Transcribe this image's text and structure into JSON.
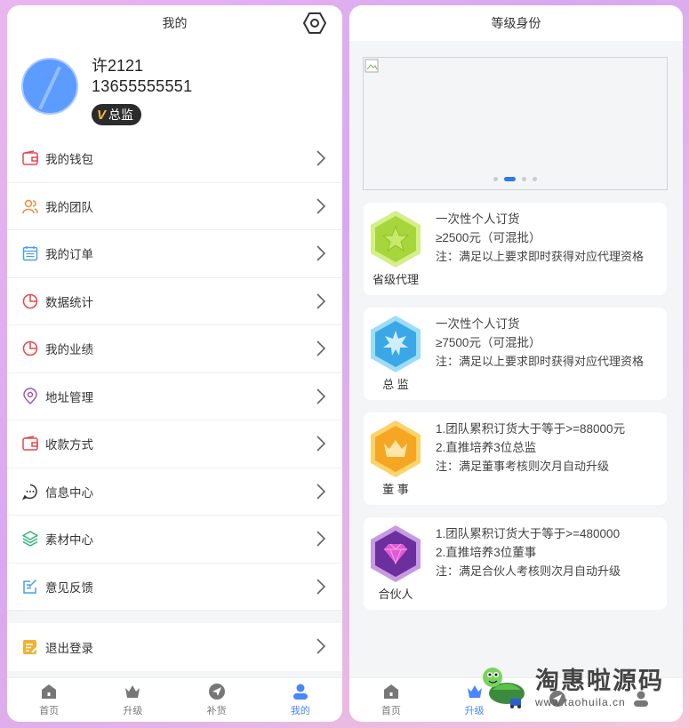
{
  "left": {
    "title": "我的",
    "user": {
      "name": "许2121",
      "phone": "13655555551",
      "level": "总监",
      "level_icon": "V"
    },
    "menu": [
      {
        "label": "我的钱包",
        "icon": "wallet-icon",
        "color": "#e5484d"
      },
      {
        "label": "我的团队",
        "icon": "team-icon",
        "color": "#f08c3a"
      },
      {
        "label": "我的订单",
        "icon": "calendar-icon",
        "color": "#4a9fe8"
      },
      {
        "label": "数据统计",
        "icon": "pie-chart-icon",
        "color": "#e5484d"
      },
      {
        "label": "我的业绩",
        "icon": "pie-chart-icon",
        "color": "#e5484d"
      },
      {
        "label": "地址管理",
        "icon": "location-pin-icon",
        "color": "#9b59b6"
      },
      {
        "label": "收款方式",
        "icon": "wallet-icon",
        "color": "#e5484d"
      },
      {
        "label": "信息中心",
        "icon": "chat-bubble-icon",
        "color": "#333333"
      },
      {
        "label": "素材中心",
        "icon": "layers-icon",
        "color": "#2fb37d"
      },
      {
        "label": "意见反馈",
        "icon": "edit-icon",
        "color": "#4a9fe8"
      }
    ],
    "logout": {
      "label": "退出登录",
      "icon": "logout-icon",
      "color": "#f2b130"
    },
    "tabs": [
      {
        "label": "首页",
        "icon": "home-icon",
        "active": false
      },
      {
        "label": "升级",
        "icon": "crown-icon",
        "active": false
      },
      {
        "label": "补货",
        "icon": "send-icon",
        "active": false
      },
      {
        "label": "我的",
        "icon": "user-icon",
        "active": true
      }
    ]
  },
  "right": {
    "title": "等级身份",
    "banner": {
      "pages": 4,
      "active_page": 2
    },
    "levels": [
      {
        "name": "省级代理",
        "badge": "star-badge-icon",
        "color": "#a6d63b",
        "lines": [
          "一次性个人订货",
          "≥2500元（可混批）",
          "注：满足以上要求即时获得对应代理资格"
        ]
      },
      {
        "name": "总 监",
        "badge": "sun-badge-icon",
        "color": "#3aa8e6",
        "lines": [
          "一次性个人订货",
          "≥7500元（可混批）",
          "注：满足以上要求即时获得对应代理资格"
        ]
      },
      {
        "name": "董 事",
        "badge": "crown-badge-icon",
        "color": "#f5a623",
        "lines": [
          "1.团队累积订货大于等于>=88000元",
          "2.直推培养3位总监",
          "注：满足董事考核则次月自动升级"
        ]
      },
      {
        "name": "合伙人",
        "badge": "diamond-badge-icon",
        "color": "#8e44ad",
        "lines": [
          "1.团队累积订货大于等于>=480000",
          "2.直推培养3位董事",
          "注：满足合伙人考核则次月自动升级"
        ]
      }
    ],
    "tabs": [
      {
        "label": "首页",
        "icon": "home-icon",
        "active": false
      },
      {
        "label": "升级",
        "icon": "crown-icon",
        "active": true
      },
      {
        "label": "",
        "icon": "send-icon",
        "active": false
      },
      {
        "label": "",
        "icon": "user-icon",
        "active": false
      }
    ]
  },
  "watermark": {
    "cn": "淘惠啦源码",
    "en": "www.taohuila.cn"
  }
}
